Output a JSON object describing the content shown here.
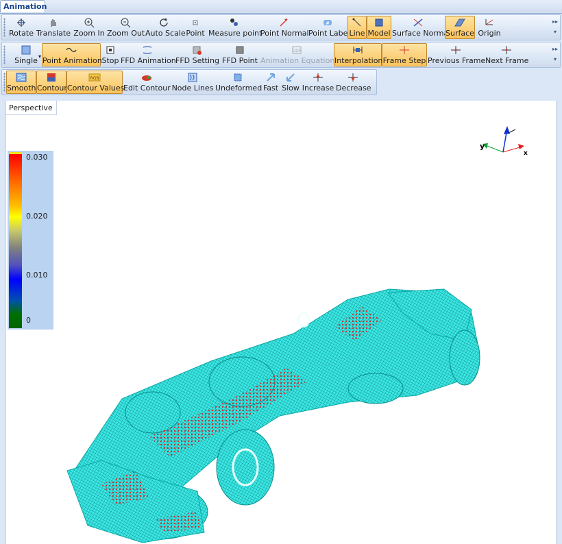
{
  "window": {
    "tab_label": "Animation"
  },
  "toolbar1": [
    {
      "id": "rotate",
      "label": "Rotate",
      "icon": "rotate-icon",
      "active": false
    },
    {
      "id": "translate",
      "label": "Translate",
      "icon": "hand-icon",
      "active": false
    },
    {
      "id": "zoom-in",
      "label": "Zoom In",
      "icon": "zoom-in-icon",
      "active": false
    },
    {
      "id": "zoom-out",
      "label": "Zoom Out",
      "icon": "zoom-out-icon",
      "active": false
    },
    {
      "id": "auto-scale",
      "label": "Auto Scale",
      "icon": "refresh-icon",
      "active": false
    },
    {
      "id": "point",
      "label": "Point",
      "icon": "point-icon",
      "active": false
    },
    {
      "id": "measure-point",
      "label": "Measure point",
      "icon": "measure-icon",
      "active": false
    },
    {
      "id": "point-normal",
      "label": "Point Normal",
      "icon": "arrow-icon",
      "active": false
    },
    {
      "id": "point-label",
      "label": "Point Label",
      "icon": "label-icon",
      "active": false
    },
    {
      "id": "line",
      "label": "Line",
      "icon": "line-icon",
      "active": true
    },
    {
      "id": "model",
      "label": "Model",
      "icon": "model-icon",
      "active": true
    },
    {
      "id": "surface-normal",
      "label": "Surface Normal",
      "icon": "normal-icon",
      "active": false
    },
    {
      "id": "surface",
      "label": "Surface",
      "icon": "surface-icon",
      "active": true
    },
    {
      "id": "origin",
      "label": "Origin",
      "icon": "origin-icon",
      "active": false
    }
  ],
  "toolbar2": [
    {
      "id": "single",
      "label": "Single",
      "icon": "square-icon",
      "active": false
    },
    {
      "id": "point-animation",
      "label": "Point Animation",
      "icon": "wave-icon",
      "active": true
    },
    {
      "id": "stop",
      "label": "Stop",
      "icon": "stop-icon",
      "active": false
    },
    {
      "id": "ffd-animation",
      "label": "FFD Animation",
      "icon": "ffd-icon",
      "active": false
    },
    {
      "id": "ffd-setting",
      "label": "FFD Setting",
      "icon": "gear-cube-icon",
      "active": false
    },
    {
      "id": "ffd-point",
      "label": "FFD Point",
      "icon": "cube-icon",
      "active": false
    },
    {
      "id": "animation-equations",
      "label": "Animation Equations",
      "icon": "equation-icon",
      "active": false,
      "disabled": true
    },
    {
      "id": "interpolation",
      "label": "Interpolation",
      "icon": "interpolation-icon",
      "active": true
    },
    {
      "id": "frame-step",
      "label": "Frame Step",
      "icon": "crosshair-icon",
      "active": true
    },
    {
      "id": "previous-frame",
      "label": "Previous Frame",
      "icon": "prev-frame-icon",
      "active": false
    },
    {
      "id": "next-frame",
      "label": "Next Frame",
      "icon": "next-frame-icon",
      "active": false
    }
  ],
  "toolbar3": [
    {
      "id": "smooth",
      "label": "Smooth",
      "icon": "smooth-icon",
      "active": true
    },
    {
      "id": "contour",
      "label": "Contour",
      "icon": "contour-icon",
      "active": true
    },
    {
      "id": "contour-values",
      "label": "Contour Values",
      "icon": "rgb-icon",
      "active": true,
      "icon_text": "RGB"
    },
    {
      "id": "edit-contour",
      "label": "Edit Contour",
      "icon": "edit-icon",
      "active": false
    },
    {
      "id": "node-lines",
      "label": "Node Lines",
      "icon": "node-lines-icon",
      "active": false
    },
    {
      "id": "undeformed",
      "label": "Undeformed",
      "icon": "undeformed-icon",
      "active": false
    },
    {
      "id": "fast",
      "label": "Fast",
      "icon": "fast-icon",
      "active": false
    },
    {
      "id": "slow",
      "label": "Slow",
      "icon": "slow-icon",
      "active": false
    },
    {
      "id": "increase",
      "label": "Increase",
      "icon": "increase-icon",
      "active": false
    },
    {
      "id": "decrease",
      "label": "Decrease",
      "icon": "decrease-icon",
      "active": false
    }
  ],
  "viewport": {
    "tab_label": "Perspective",
    "legend": {
      "ticks": [
        "0.030",
        "0.020",
        "0.010",
        "0"
      ]
    },
    "axes": {
      "x_label": "x",
      "y_label": "y"
    }
  },
  "colors": {
    "accent": "#fbc45d",
    "mesh": "#29e6e0",
    "hotspot": "#d43030"
  }
}
